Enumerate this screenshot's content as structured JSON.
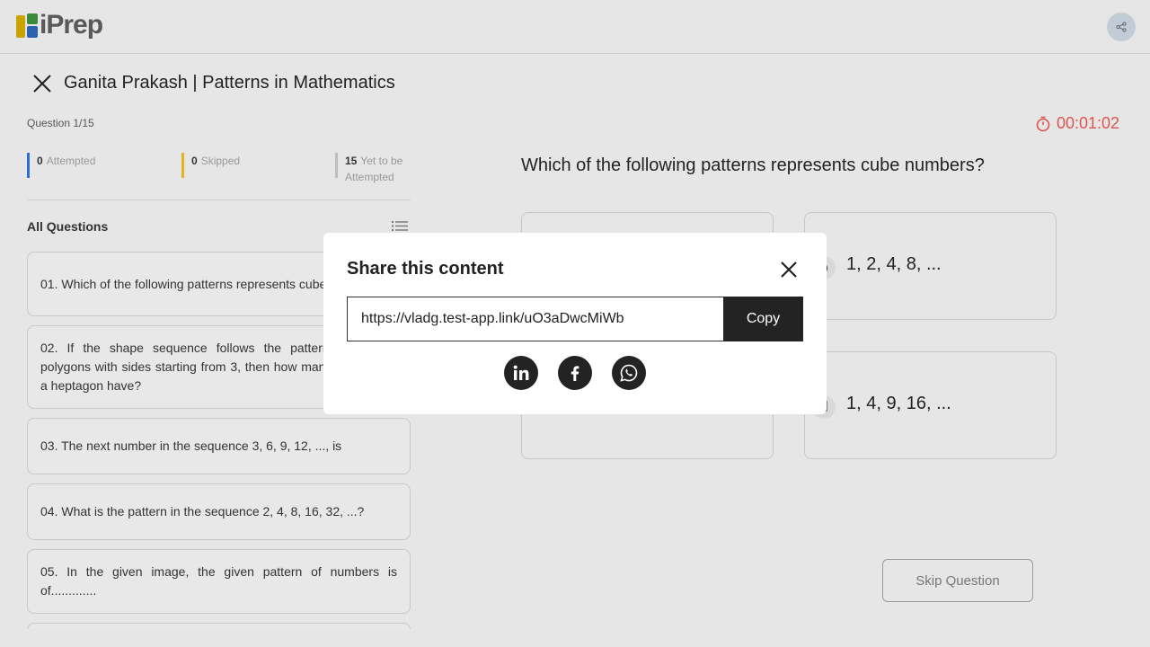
{
  "header": {
    "logo_text": "iPrep",
    "share_icon": "share-icon"
  },
  "title": "Ganita Prakash | Patterns in Mathematics",
  "question_counter": "Question 1/15",
  "timer": "00:01:02",
  "stats": {
    "attempted_count": "0",
    "attempted_label": "Attempted",
    "skipped_count": "0",
    "skipped_label": "Skipped",
    "yet_count": "15",
    "yet_label_1": "Yet to be",
    "yet_label_2": "Attempted"
  },
  "all_questions_label": "All Questions",
  "questions": [
    {
      "text": "01. Which of the following patterns represents cube numbers?"
    },
    {
      "text": "02. If the shape sequence follows the pattern of regular polygons with sides starting from 3, then how many sides does a heptagon have?"
    },
    {
      "text": "03. The next number in the sequence 3, 6, 9, 12, ..., is"
    },
    {
      "text": "04. What is the pattern in the sequence 2, 4, 8, 16, 32, ...?"
    },
    {
      "text": "05. In the given image, the given pattern of numbers is of............."
    }
  ],
  "current_question": "Which of the following patterns represents cube numbers?",
  "options": [
    {
      "letter": "b",
      "value": "1, 2, 4, 8, ..."
    },
    {
      "letter": "d",
      "value": "1, 4, 9, 16, ..."
    }
  ],
  "skip_label": "Skip Question",
  "modal": {
    "title": "Share this content",
    "link": "https://vladg.test-app.link/uO3aDwcMiWb",
    "copy_label": "Copy",
    "socials": [
      "linkedin-icon",
      "facebook-icon",
      "whatsapp-icon"
    ]
  },
  "colors": {
    "attempted": "#2c6fd4",
    "skipped": "#e2b418",
    "timer": "#e0544e",
    "button_dark": "#232323"
  }
}
